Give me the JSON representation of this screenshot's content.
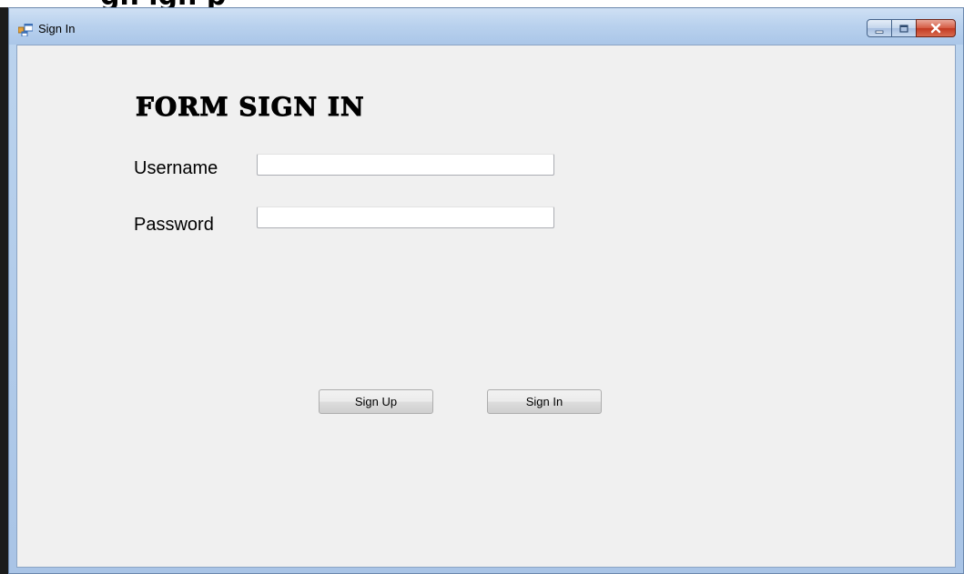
{
  "window": {
    "title": "Sign In",
    "icon": "form-app-icon",
    "caption_buttons": {
      "minimize": "minimize-icon",
      "maximize": "maximize-icon",
      "close": "close-icon"
    }
  },
  "background_overlay": {
    "partial_text": "gn  ign  p"
  },
  "form": {
    "heading": "FORM SIGN IN",
    "username_label": "Username",
    "username_value": "",
    "password_label": "Password",
    "password_value": ""
  },
  "buttons": {
    "sign_up_label": "Sign Up",
    "sign_in_label": "Sign In"
  },
  "colors": {
    "client_background": "#f0f0f0",
    "titlebar": "#bad2ee",
    "close_button": "#d45a42"
  }
}
